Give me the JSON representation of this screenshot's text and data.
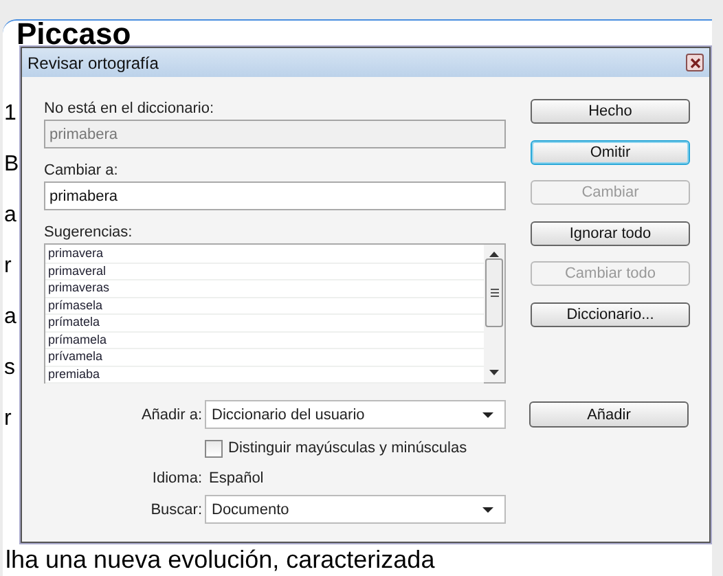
{
  "document": {
    "heading": "Piccaso",
    "line_starts": [
      "1",
      "B",
      "a",
      "r",
      "a",
      "s",
      "r"
    ],
    "last_line": "lha una nueva evolución, caracterizada"
  },
  "dialog": {
    "title": "Revisar ortografía",
    "not_in_dictionary": {
      "label": "No está en el diccionario:",
      "value": "primabera",
      "disabled": true
    },
    "change_to": {
      "label": "Cambiar a:",
      "value": "primabera"
    },
    "suggestions": {
      "label": "Sugerencias:",
      "items": [
        {
          "text": "primavera",
          "selected": false
        },
        {
          "text": "primaveral",
          "selected": false
        },
        {
          "text": "primaveras",
          "selected": false
        },
        {
          "text": "prímasela",
          "selected": false
        },
        {
          "text": "prímatela",
          "selected": false
        },
        {
          "text": "prímamela",
          "selected": false
        },
        {
          "text": "prívamela",
          "selected": false
        },
        {
          "text": "premiaba",
          "selected": false
        }
      ]
    },
    "buttons": [
      {
        "label": "Hecho",
        "disabled": false,
        "focused": false
      },
      {
        "label": "Omitir",
        "disabled": false,
        "focused": true
      },
      {
        "label": "Cambiar",
        "disabled": true,
        "focused": false
      },
      {
        "label": "Ignorar todo",
        "disabled": false,
        "focused": false
      },
      {
        "label": "Cambiar todo",
        "disabled": true,
        "focused": false
      },
      {
        "label": "Diccionario...",
        "disabled": false,
        "focused": false
      }
    ],
    "add_to": {
      "label": "Añadir a:",
      "value": "Diccionario del usuario"
    },
    "add_button": {
      "label": "Añadir",
      "disabled": false
    },
    "match_case": {
      "label": "Distinguir mayúsculas y minúsculas",
      "checked": false
    },
    "language": {
      "label": "Idioma:",
      "value": "Español"
    },
    "search_in": {
      "label": "Buscar:",
      "value": "Documento"
    }
  }
}
